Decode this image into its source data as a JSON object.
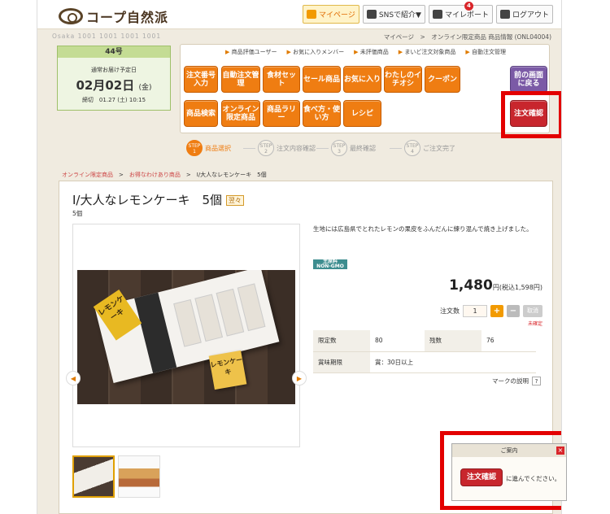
{
  "header": {
    "logo_text": "コープ自然派",
    "buttons": [
      {
        "label": "マイページ",
        "icon": "home-icon"
      },
      {
        "label": "SNSで紹介▼",
        "icon": "mail-icon"
      },
      {
        "label": "マイレポート",
        "icon": "report-icon",
        "badge": "4"
      },
      {
        "label": "ログアウト",
        "icon": "lock-icon"
      }
    ]
  },
  "subheader": {
    "member_name": "Osaka 1001 1001 1001 1001",
    "breadcrumb": "マイページ　>　オンライン限定商品 商品情報 (ONL04004)"
  },
  "delivery": {
    "week": "44号",
    "label": "通常お届け予定日",
    "date_main": "02月02日",
    "date_day": "(金)",
    "deadline": "締切　01.27 (土) 10:15"
  },
  "nav": {
    "links": [
      "商品評価ユーザー",
      "お気に入りメンバー",
      "未評価商品",
      "まいど注文対象商品",
      "自動注文管理"
    ],
    "tiles_row1": [
      "注文番号入力",
      "自動注文管理",
      "食材セット",
      "セール商品",
      "お気に入り",
      "わたしのイチオシ",
      "クーポン"
    ],
    "tiles_row2": [
      "商品検索",
      "オンライン限定商品",
      "商品ラリー",
      "食べ方・使い方",
      "レシピ"
    ],
    "back": "前の画面に戻る",
    "confirm": "注文確認"
  },
  "steps": [
    {
      "num": "STEP 1",
      "label": "商品選択"
    },
    {
      "num": "STEP 2",
      "label": "注文内容確認"
    },
    {
      "num": "STEP 3",
      "label": "最終確認"
    },
    {
      "num": "STEP 4",
      "label": "ご注文完了"
    }
  ],
  "page_breadcrumb": {
    "a": "オンライン限定商品",
    "b": "お得なわけあり商品",
    "c": "I/大人なレモンケーキ　5個"
  },
  "product": {
    "title": "I/大人なレモンケーキ　5個",
    "tag": "翌々",
    "quantity_text": "5個",
    "description": "生地には広島県でとれたレモンの果皮をふんだんに練り混んで焼き上げました。",
    "gmo_line1": "主原料",
    "gmo_line2": "NON-GMO",
    "price": "1,480",
    "price_suffix": "円(税込1,598円)",
    "qty_label": "注文数",
    "qty_value": "1",
    "plus": "+",
    "minus": "−",
    "cancel": "取消",
    "unconfirmed": "未確定",
    "box_label": "レモンケーキ",
    "spec": [
      {
        "k1": "限定数",
        "v1": "80",
        "k2": "残数",
        "v2": "76"
      },
      {
        "k1": "賞味期限",
        "v1": "賞：30日以上",
        "k2": "",
        "v2": ""
      }
    ],
    "mark_help": "マークの説明",
    "mark_q": "?"
  },
  "notice": {
    "title": "ご案内",
    "close": "×",
    "button": "注文確認",
    "text": "に進んでください。"
  }
}
